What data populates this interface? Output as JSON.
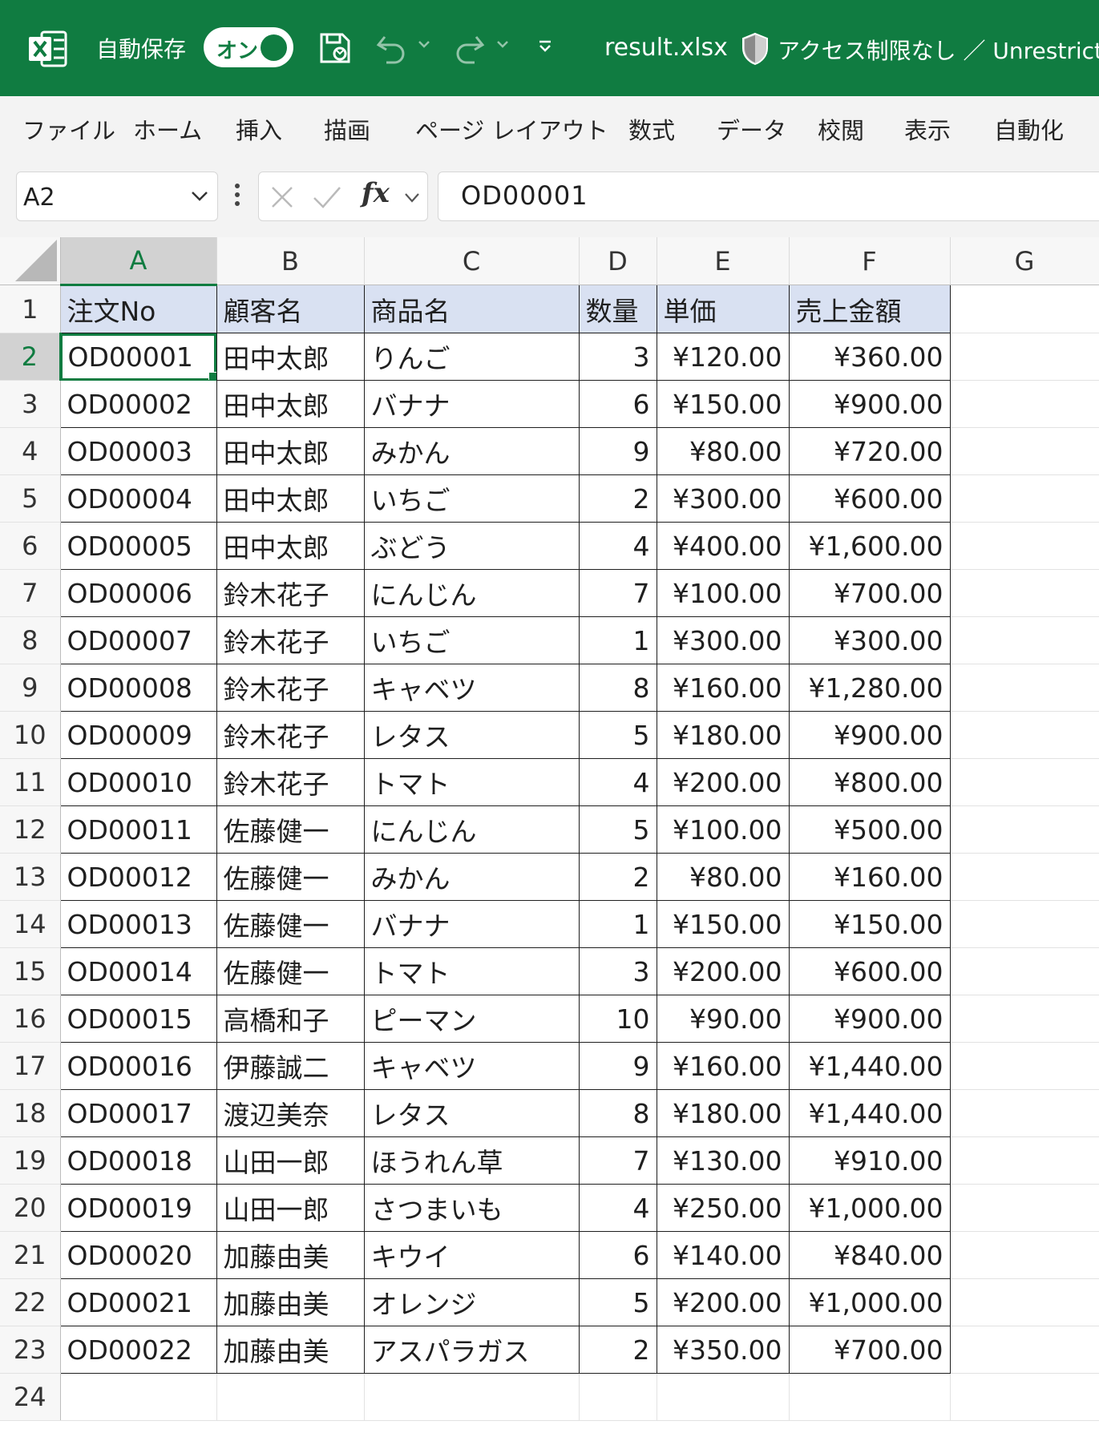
{
  "titlebar": {
    "autosave_label": "自動保存",
    "autosave_state": "オン",
    "filename": "result.xlsx",
    "access_label": "アクセス制限なし ／ Unrestricted",
    "accent_color": "#107c41"
  },
  "ribbon": {
    "tabs": [
      "ファイル",
      "ホーム",
      "挿入",
      "描画",
      "ページ レイアウト",
      "数式",
      "データ",
      "校閲",
      "表示",
      "自動化"
    ]
  },
  "formula_bar": {
    "name_box": "A2",
    "fx_label": "fx",
    "content": "OD00001"
  },
  "sheet": {
    "columns": [
      "A",
      "B",
      "C",
      "D",
      "E",
      "F",
      "G"
    ],
    "selected_column": "A",
    "selected_row": "2",
    "header_fill": "#d9e1f2",
    "headers": [
      "注文No",
      "顧客名",
      "商品名",
      "数量",
      "単価",
      "売上金額"
    ],
    "rows": [
      [
        "OD00001",
        "田中太郎",
        "りんご",
        "3",
        "¥120.00",
        "¥360.00"
      ],
      [
        "OD00002",
        "田中太郎",
        "バナナ",
        "6",
        "¥150.00",
        "¥900.00"
      ],
      [
        "OD00003",
        "田中太郎",
        "みかん",
        "9",
        "¥80.00",
        "¥720.00"
      ],
      [
        "OD00004",
        "田中太郎",
        "いちご",
        "2",
        "¥300.00",
        "¥600.00"
      ],
      [
        "OD00005",
        "田中太郎",
        "ぶどう",
        "4",
        "¥400.00",
        "¥1,600.00"
      ],
      [
        "OD00006",
        "鈴木花子",
        "にんじん",
        "7",
        "¥100.00",
        "¥700.00"
      ],
      [
        "OD00007",
        "鈴木花子",
        "いちご",
        "1",
        "¥300.00",
        "¥300.00"
      ],
      [
        "OD00008",
        "鈴木花子",
        "キャベツ",
        "8",
        "¥160.00",
        "¥1,280.00"
      ],
      [
        "OD00009",
        "鈴木花子",
        "レタス",
        "5",
        "¥180.00",
        "¥900.00"
      ],
      [
        "OD00010",
        "鈴木花子",
        "トマト",
        "4",
        "¥200.00",
        "¥800.00"
      ],
      [
        "OD00011",
        "佐藤健一",
        "にんじん",
        "5",
        "¥100.00",
        "¥500.00"
      ],
      [
        "OD00012",
        "佐藤健一",
        "みかん",
        "2",
        "¥80.00",
        "¥160.00"
      ],
      [
        "OD00013",
        "佐藤健一",
        "バナナ",
        "1",
        "¥150.00",
        "¥150.00"
      ],
      [
        "OD00014",
        "佐藤健一",
        "トマト",
        "3",
        "¥200.00",
        "¥600.00"
      ],
      [
        "OD00015",
        "高橋和子",
        "ピーマン",
        "10",
        "¥90.00",
        "¥900.00"
      ],
      [
        "OD00016",
        "伊藤誠二",
        "キャベツ",
        "9",
        "¥160.00",
        "¥1,440.00"
      ],
      [
        "OD00017",
        "渡辺美奈",
        "レタス",
        "8",
        "¥180.00",
        "¥1,440.00"
      ],
      [
        "OD00018",
        "山田一郎",
        "ほうれん草",
        "7",
        "¥130.00",
        "¥910.00"
      ],
      [
        "OD00019",
        "山田一郎",
        "さつまいも",
        "4",
        "¥250.00",
        "¥1,000.00"
      ],
      [
        "OD00020",
        "加藤由美",
        "キウイ",
        "6",
        "¥140.00",
        "¥840.00"
      ],
      [
        "OD00021",
        "加藤由美",
        "オレンジ",
        "5",
        "¥200.00",
        "¥1,000.00"
      ],
      [
        "OD00022",
        "加藤由美",
        "アスパラガス",
        "2",
        "¥350.00",
        "¥700.00"
      ]
    ],
    "empty_rows": [
      "24"
    ]
  }
}
